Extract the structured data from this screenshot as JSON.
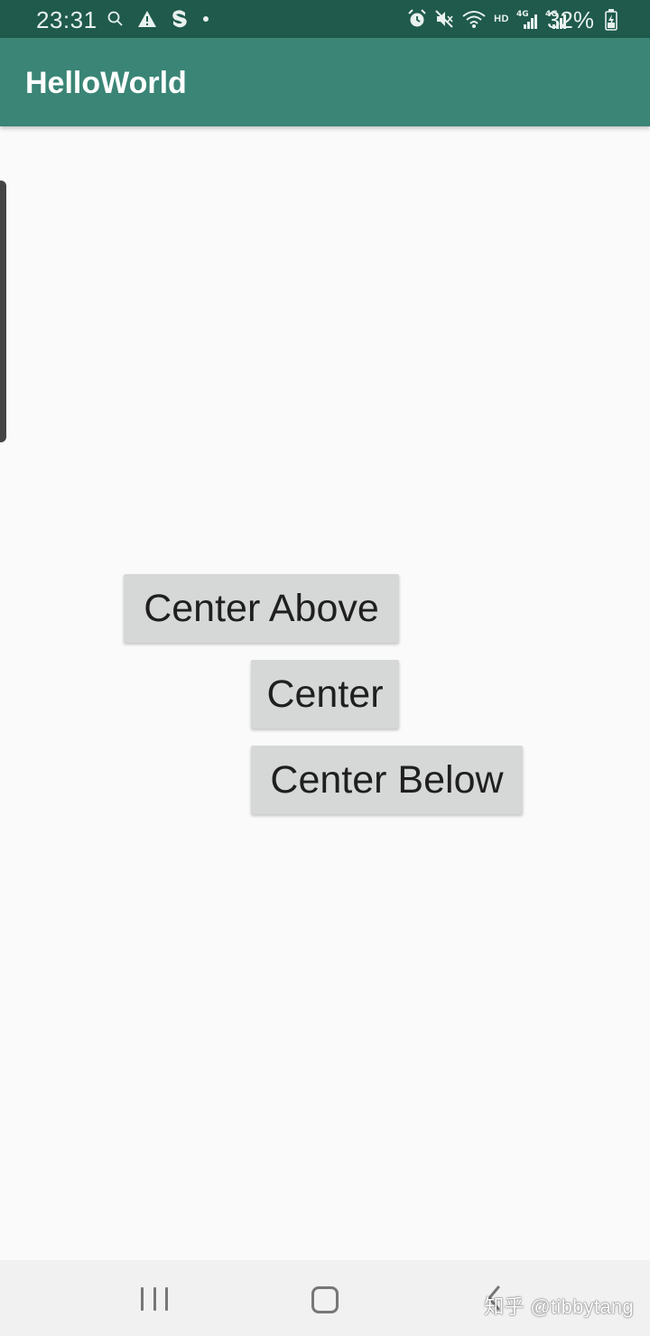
{
  "status_bar": {
    "time": "23:31",
    "battery_percent": "32%",
    "network_label": "HD",
    "left_icons": [
      "search-icon",
      "warning-icon",
      "s-app-icon",
      "dot-icon"
    ],
    "right_icons": [
      "alarm-icon",
      "mute-icon",
      "wifi-icon",
      "signal-4g-icon",
      "signal-4g-icon",
      "battery-icon"
    ]
  },
  "app_bar": {
    "title": "HelloWorld",
    "color": "#3a8576"
  },
  "buttons": {
    "center_above": "Center Above",
    "center": "Center",
    "center_below": "Center Below"
  },
  "nav_bar": {
    "icons": [
      "recents-icon",
      "home-icon",
      "back-icon"
    ]
  },
  "watermark": "知乎 @tibbytang",
  "colors": {
    "status_bar": "#1f5a4c",
    "app_bar": "#3a8576",
    "background": "#fafafa",
    "button": "#d6d7d7"
  }
}
